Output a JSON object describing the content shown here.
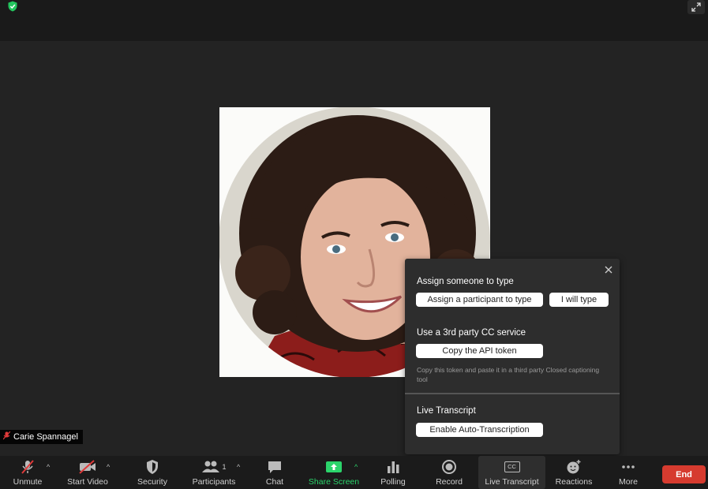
{
  "participant": {
    "name": "Carie Spannagel"
  },
  "popup": {
    "assign_title": "Assign someone to type",
    "assign_participant_btn": "Assign a participant to type",
    "i_will_type_btn": "I will type",
    "third_party_title": "Use a 3rd party CC service",
    "copy_token_btn": "Copy the API token",
    "hint": "Copy this token and paste it in a third party Closed captioning tool",
    "live_transcript_title": "Live Transcript",
    "enable_auto_btn": "Enable Auto-Transcription"
  },
  "toolbar": {
    "unmute": "Unmute",
    "start_video": "Start Video",
    "security": "Security",
    "participants": "Participants",
    "participants_count": "1",
    "chat": "Chat",
    "share_screen": "Share Screen",
    "polling": "Polling",
    "record": "Record",
    "live_transcript": "Live Transcript",
    "cc_badge": "CC",
    "reactions": "Reactions",
    "more": "More",
    "end": "End"
  },
  "colors": {
    "share_green": "#2bd46b",
    "end_red": "#d63b2f",
    "shield_green": "#23c55e"
  }
}
